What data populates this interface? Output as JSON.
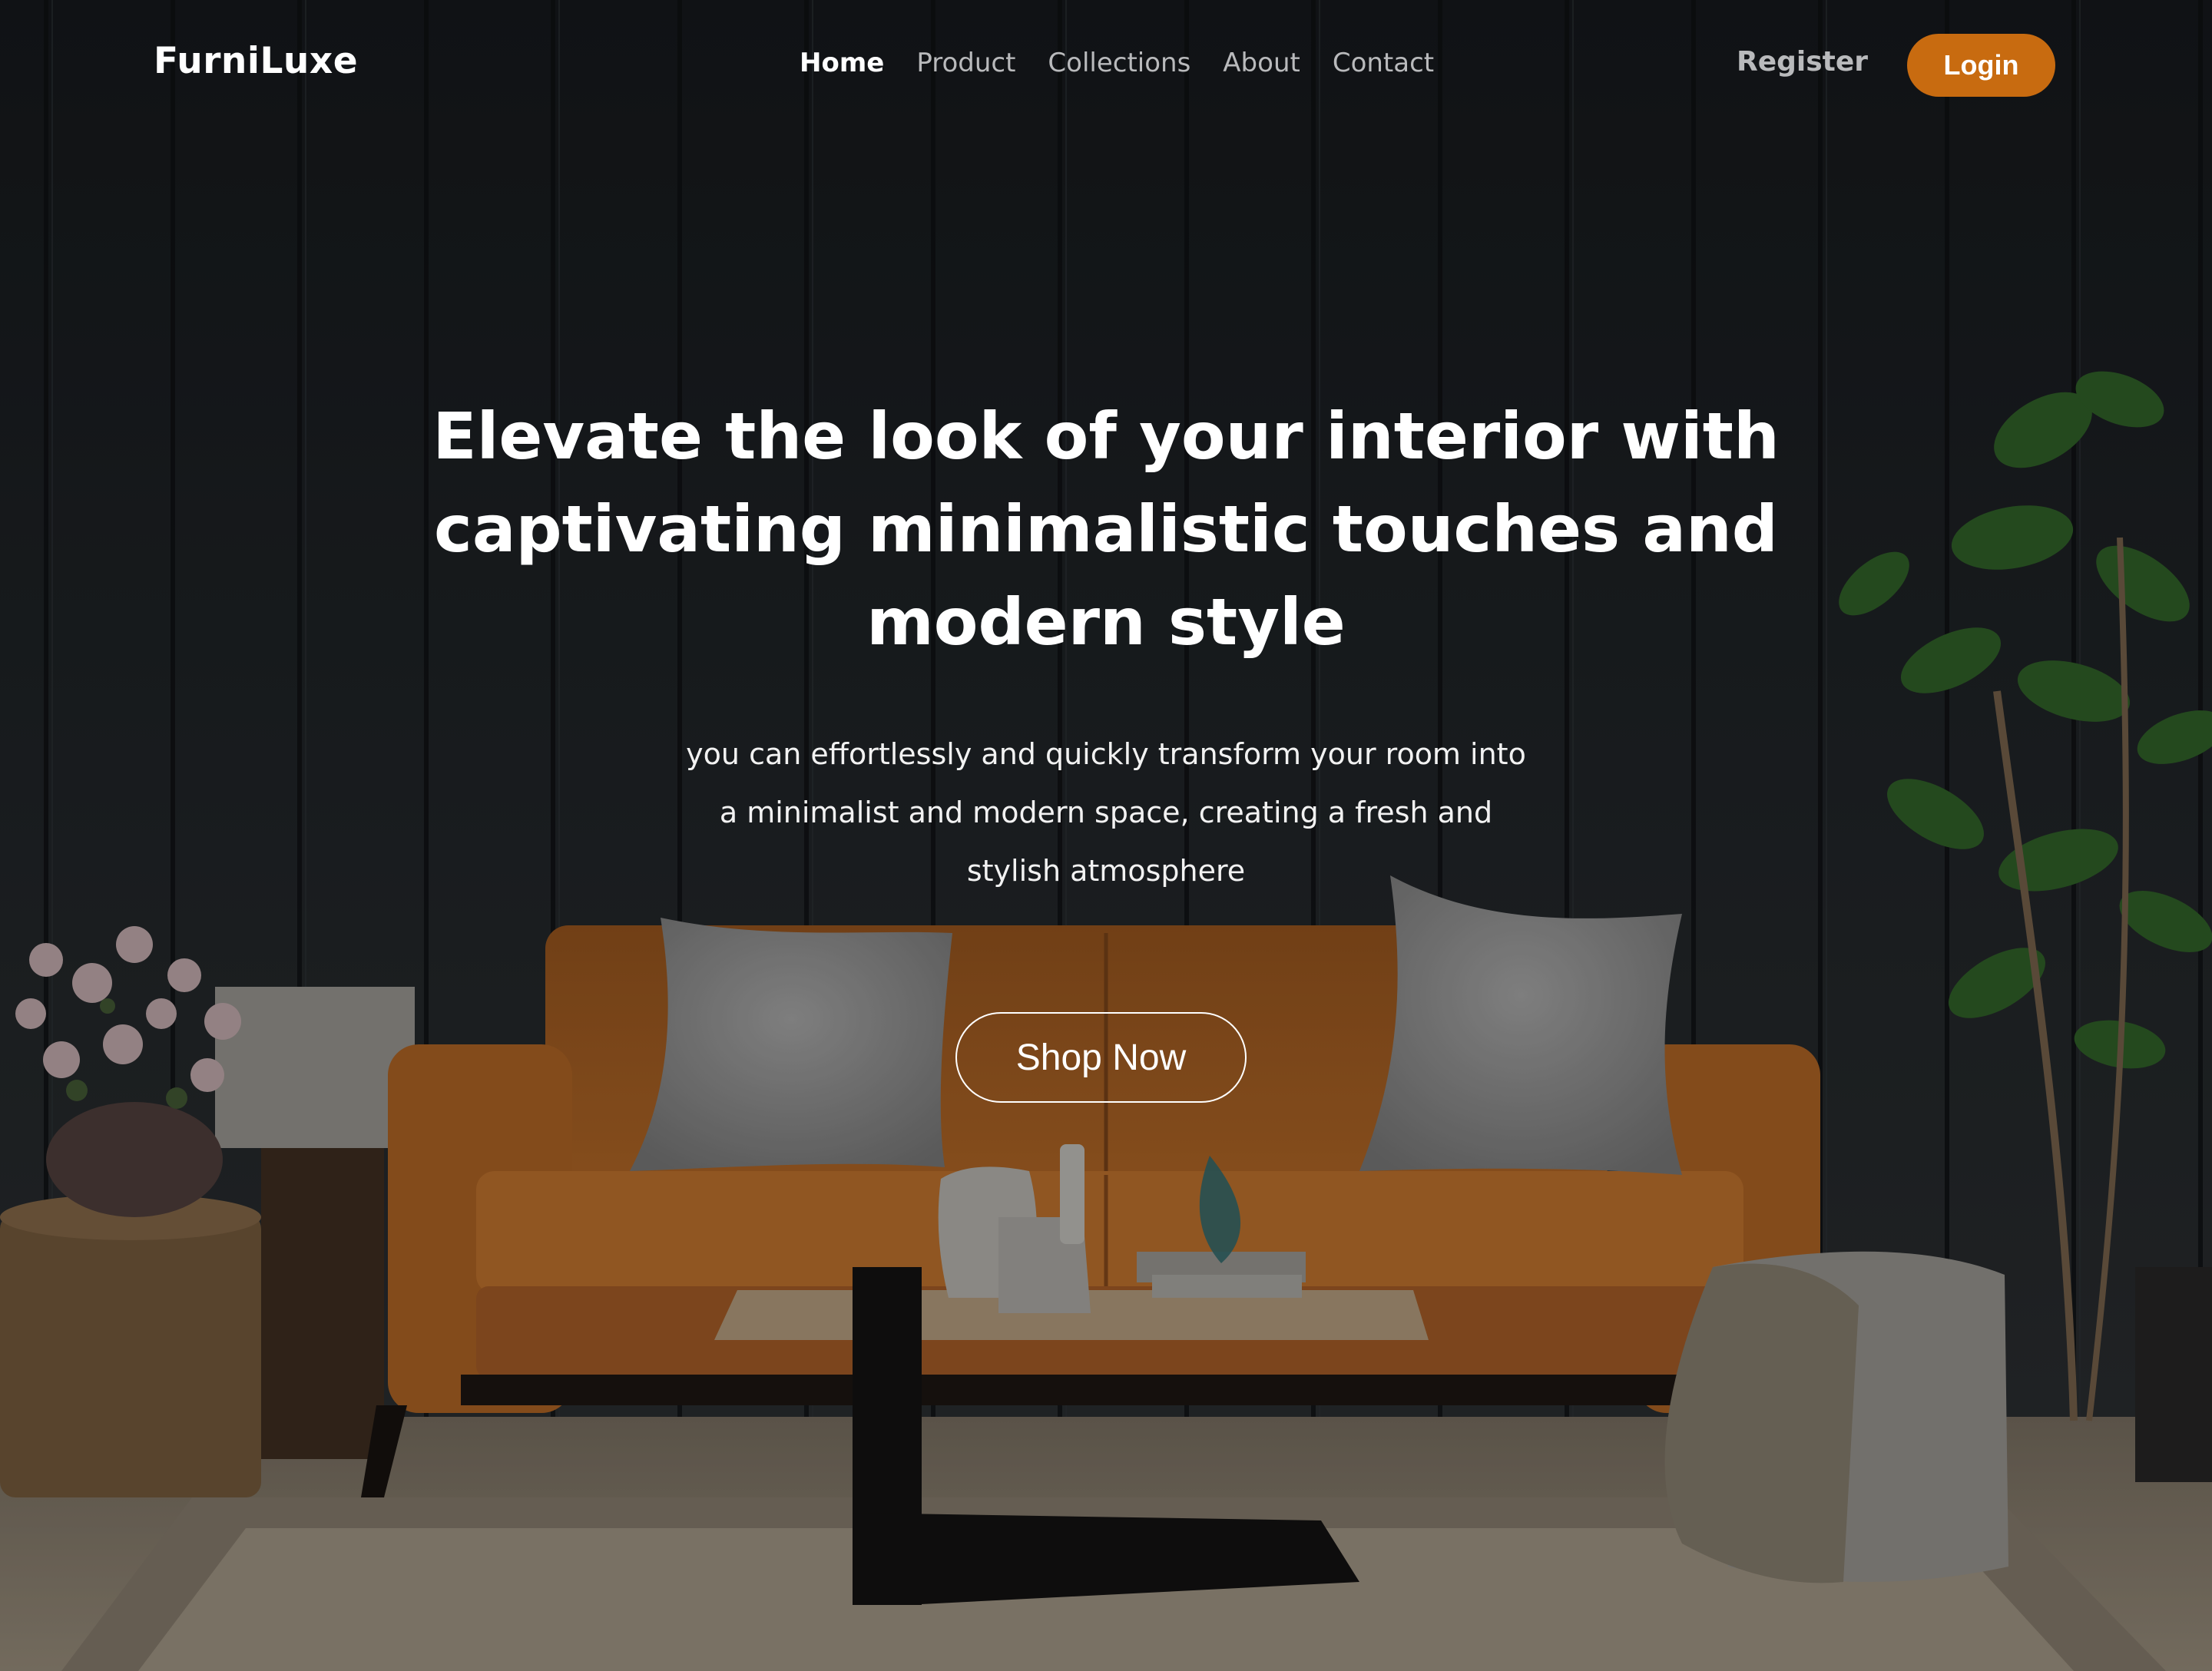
{
  "brand": {
    "name": "FurniLuxe"
  },
  "nav": {
    "links": [
      "Home",
      "Product",
      "Collections",
      "About",
      "Contact"
    ],
    "active": "Home",
    "register_label": "Register",
    "login_label": "Login"
  },
  "hero": {
    "headline": "Elevate the look of your interior with captivating minimalistic touches and modern style",
    "subtext": "you can effortlessly and quickly transform your room into a minimalist and modern space, creating a fresh and stylish atmosphere",
    "cta_label": "Shop Now"
  },
  "colors": {
    "accent": "#c86b10",
    "background": "#1c1f22",
    "nav_text": "#b9babc",
    "text": "#ffffff"
  }
}
